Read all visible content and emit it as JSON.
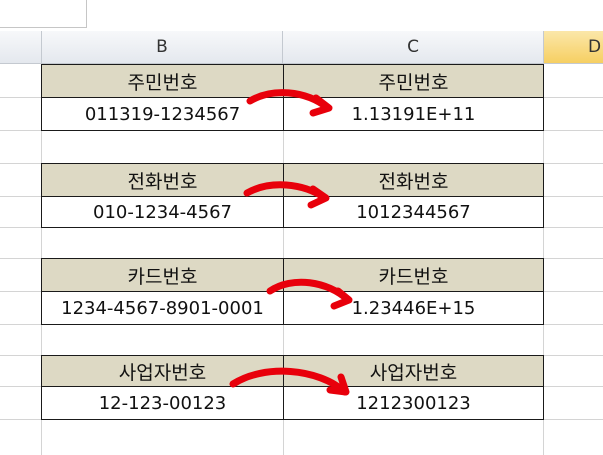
{
  "sheet": {
    "columns": [
      "B",
      "C",
      "D"
    ],
    "active_column": "D"
  },
  "tables": [
    {
      "left_header": "주민번호",
      "right_header": "주민번호",
      "left_value": "011319-1234567",
      "right_value": "1.13191E+11"
    },
    {
      "left_header": "전화번호",
      "right_header": "전화번호",
      "left_value": "010-1234-4567",
      "right_value": "1012344567"
    },
    {
      "left_header": "카드번호",
      "right_header": "카드번호",
      "left_value": "1234-4567-8901-0001",
      "right_value": "1.23446E+15"
    },
    {
      "left_header": "사업자번호",
      "right_header": "사업자번호",
      "left_value": "12-123-00123",
      "right_value": "1212300123"
    }
  ],
  "annotation_color": "#e8000b",
  "header_fill_color": "#ddd9c4",
  "active_column_color": "#f6cf62"
}
